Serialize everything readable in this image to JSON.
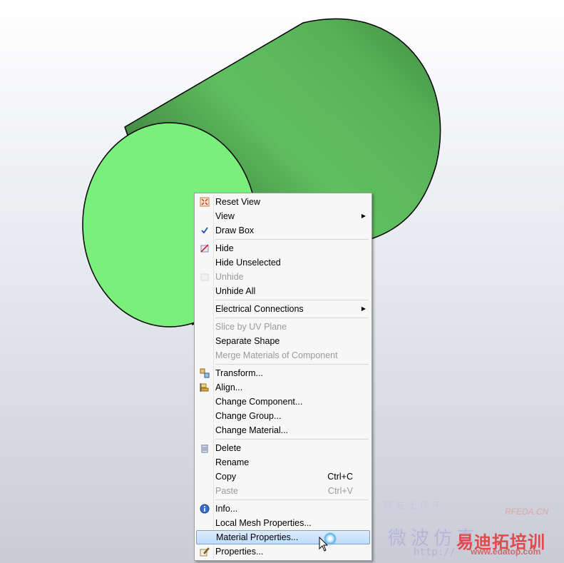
{
  "viewport": {
    "background_top": "#ffffff",
    "background_bottom": "#c9ccd7",
    "shape_color": "#5fbf5f",
    "face_color": "#7bef7b"
  },
  "menu": {
    "items": [
      {
        "label": "Reset View",
        "icon": "reset-view-icon",
        "disabled": false
      },
      {
        "label": "View",
        "submenu": true
      },
      {
        "label": "Draw Box",
        "checked": true,
        "underline_char": "B"
      },
      {
        "separator": true
      },
      {
        "label": "Hide",
        "icon": "hide-icon"
      },
      {
        "label": "Hide Unselected"
      },
      {
        "label": "Unhide",
        "icon": "unhide-icon",
        "disabled": true
      },
      {
        "label": "Unhide All"
      },
      {
        "separator": true
      },
      {
        "label": "Electrical Connections",
        "submenu": true
      },
      {
        "separator": true
      },
      {
        "label": "Slice by UV Plane",
        "disabled": true
      },
      {
        "label": "Separate Shape"
      },
      {
        "label": "Merge Materials of Component",
        "disabled": true
      },
      {
        "separator": true
      },
      {
        "label": "Transform...",
        "icon": "transform-icon"
      },
      {
        "label": "Align...",
        "icon": "align-icon"
      },
      {
        "label": "Change Component..."
      },
      {
        "label": "Change Group..."
      },
      {
        "label": "Change Material..."
      },
      {
        "separator": true
      },
      {
        "label": "Delete",
        "icon": "delete-icon"
      },
      {
        "label": "Rename"
      },
      {
        "label": "Copy",
        "shortcut": "Ctrl+C"
      },
      {
        "label": "Paste",
        "shortcut": "Ctrl+V",
        "disabled": true
      },
      {
        "separator": true
      },
      {
        "label": "Info...",
        "icon": "info-icon"
      },
      {
        "label": "Local Mesh Properties..."
      },
      {
        "label": "Material Properties...",
        "highlighted": true
      },
      {
        "label": "Properties...",
        "icon": "properties-icon"
      }
    ],
    "highlight_color": "#c1dcfc"
  },
  "watermark": {
    "line1": "网友上传于",
    "brand": "RFEDA.CN",
    "line2": "微波仿真",
    "line3": "易迪拓培训",
    "url": "http://",
    "url2": "www.edatop.com"
  }
}
